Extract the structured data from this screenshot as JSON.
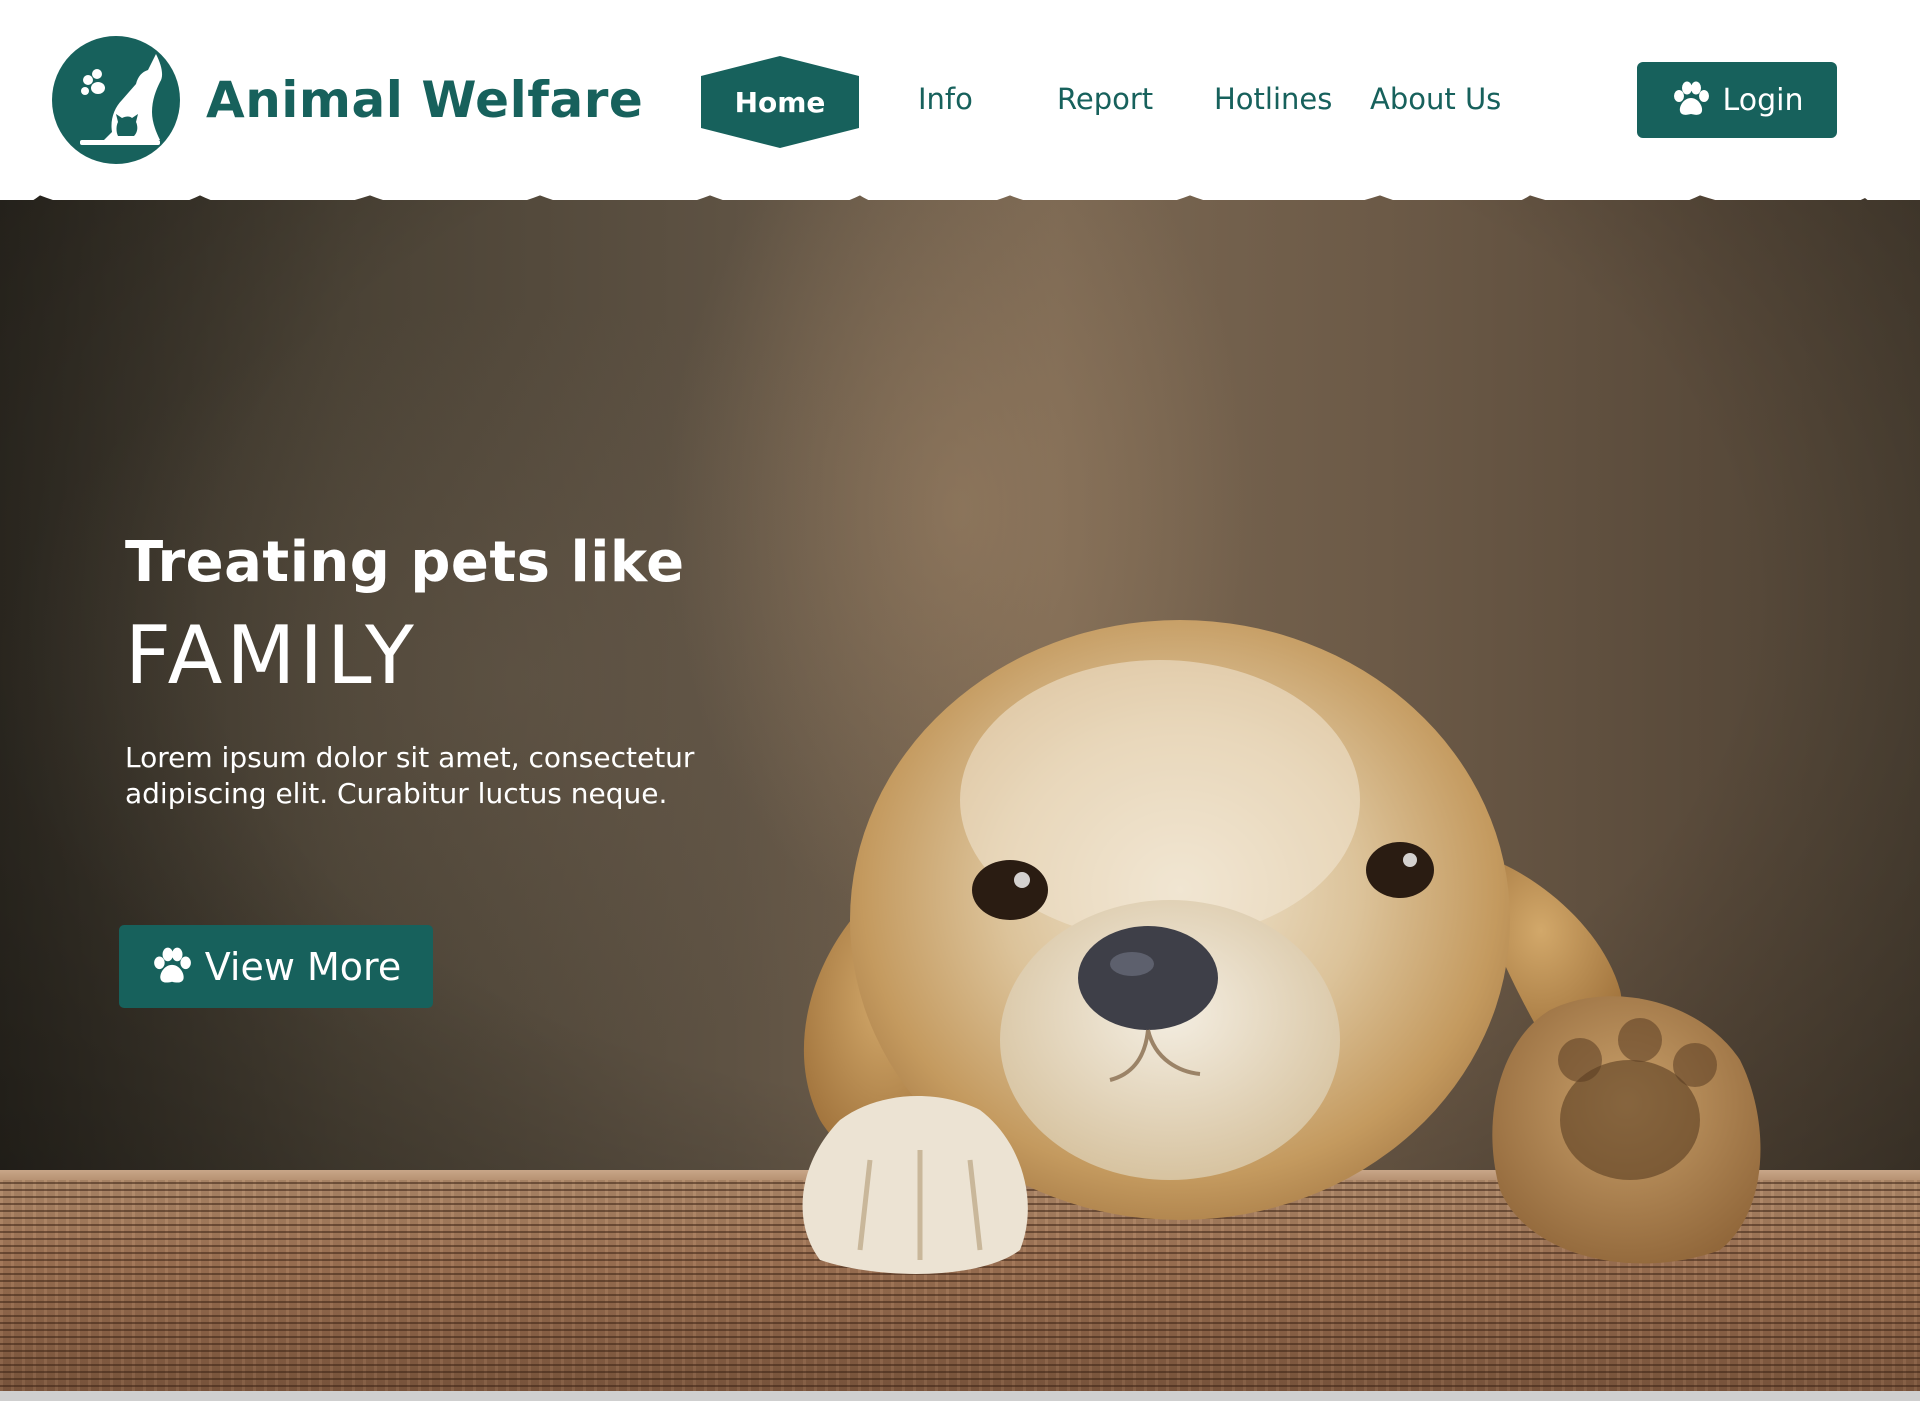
{
  "brand": {
    "name": "Animal Welfare",
    "logo_icon": "dog-cat-paw-logo"
  },
  "nav": {
    "items": [
      {
        "label": "Home",
        "active": true
      },
      {
        "label": "Info"
      },
      {
        "label": "Report"
      },
      {
        "label": "Hotlines"
      },
      {
        "label": "About Us"
      }
    ],
    "login_label": "Login",
    "login_icon": "paw-icon"
  },
  "hero": {
    "headline_line1": "Treating pets like",
    "headline_line2": "FAMILY",
    "description": "Lorem ipsum dolor sit amet, consectetur adipiscing elit. Curabitur luctus neque.",
    "cta_label": "View More",
    "cta_icon": "paw-icon",
    "image": "puppy-resting-on-wooden-ledge"
  },
  "colors": {
    "brand": "#17615c",
    "header_bg": "#ffffff",
    "text_on_dark": "#ffffff"
  }
}
